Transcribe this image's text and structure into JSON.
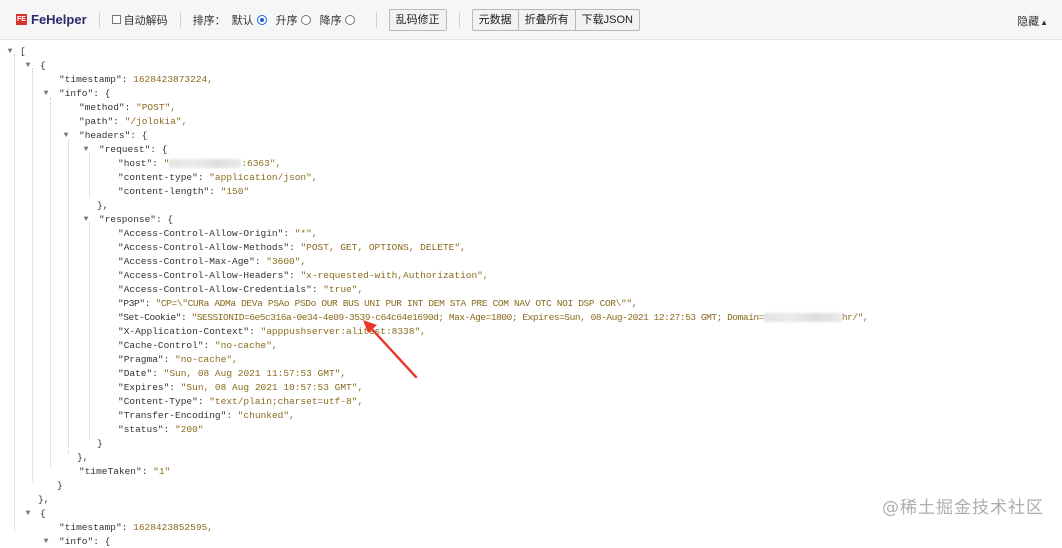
{
  "toolbar": {
    "logo_text": "FeHelper",
    "auto_decode_label": "自动解码",
    "sort_label": "排序：",
    "sort_options": [
      "默认",
      "升序",
      "降序"
    ],
    "sort_selected": "默认",
    "fix_garbled_label": "乱码修正",
    "raw_data_label": "元数据",
    "collapse_all_label": "折叠所有",
    "download_json_label": "下载JSON",
    "hide_label": "隐藏"
  },
  "tree": {
    "open_bracket": "[",
    "open_brace": "{",
    "close_brace": "}",
    "close_brace_comma": "},",
    "close_bracket": "]",
    "records": [
      {
        "timestamp_key": "\"timestamp\":",
        "timestamp_value": "1628423873224,",
        "info_key": "\"info\":",
        "method_key": "\"method\":",
        "method_value": "\"POST\",",
        "path_key": "\"path\":",
        "path_value": "\"/jolokia\",",
        "headers_key": "\"headers\":",
        "request_key": "\"request\":",
        "request": {
          "host_key": "\"host\":",
          "host_value_prefix": "\"",
          "host_value_suffix": ":6363\",",
          "content_type_key": "\"content-type\":",
          "content_type_value": "\"application/json\",",
          "content_length_key": "\"content-length\":",
          "content_length_value": "\"150\""
        },
        "response_key": "\"response\":",
        "response": [
          {
            "k": "\"Access-Control-Allow-Origin\":",
            "v": "\"*\","
          },
          {
            "k": "\"Access-Control-Allow-Methods\":",
            "v": "\"POST, GET, OPTIONS, DELETE\","
          },
          {
            "k": "\"Access-Control-Max-Age\":",
            "v": "\"3600\","
          },
          {
            "k": "\"Access-Control-Allow-Headers\":",
            "v": "\"x-requested-with,Authorization\","
          },
          {
            "k": "\"Access-Control-Allow-Credentials\":",
            "v": "\"true\","
          },
          {
            "k": "\"P3P\":",
            "v": "\"CP=\\\"CURa ADMa DEVa PSAo PSDo OUR BUS UNI PUR INT DEM STA PRE COM NAV OTC NOI DSP COR\\\"\","
          },
          {
            "k": "\"Set-Cookie\":",
            "v": "\"SESSIONID=6e5c316a-0e34-4e09-3539-c64c64e1690d; Max-Age=1800; Expires=Sun, 08-Aug-2021 12:27:53 GMT; Domain=",
            "v2": "hr/\","
          },
          {
            "k": "\"X-Application-Context\":",
            "v": "\"apppushserver:alitest:8338\","
          },
          {
            "k": "\"Cache-Control\":",
            "v": "\"no-cache\","
          },
          {
            "k": "\"Pragma\":",
            "v": "\"no-cache\","
          },
          {
            "k": "\"Date\":",
            "v": "\"Sun, 08 Aug 2021 11:57:53 GMT\","
          },
          {
            "k": "\"Expires\":",
            "v": "\"Sun, 08 Aug 2021 10:57:53 GMT\","
          },
          {
            "k": "\"Content-Type\":",
            "v": "\"text/plain;charset=utf-8\","
          },
          {
            "k": "\"Transfer-Encoding\":",
            "v": "\"chunked\","
          },
          {
            "k": "\"status\":",
            "v": "\"200\""
          }
        ],
        "time_taken_key": "\"timeTaken\":",
        "time_taken_value": "\"1\""
      },
      {
        "timestamp_key": "\"timestamp\":",
        "timestamp_value": "1628423852595,",
        "info_key": "\"info\":"
      }
    ]
  },
  "watermark": "@稀土掘金技术社区",
  "colors": {
    "toolbar_bg": "#f6f6f6",
    "value_color": "#8a6a1c",
    "arrow_color": "#e8372b",
    "logo_red": "#d6332b"
  }
}
